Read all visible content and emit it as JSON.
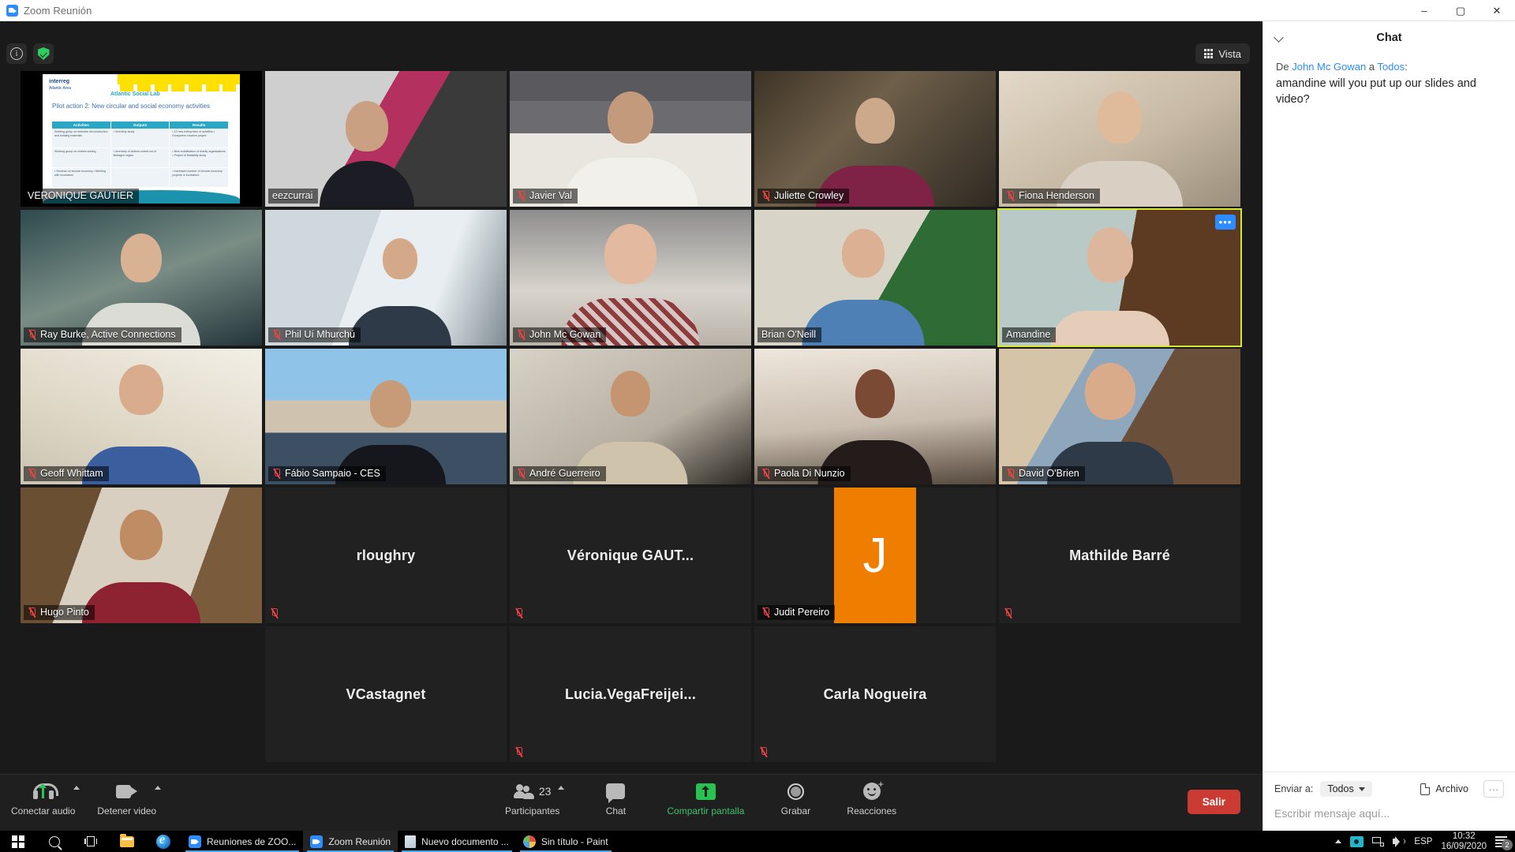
{
  "window": {
    "title": "Zoom Reunión",
    "app_icon": "zoom-icon",
    "minimize": "–",
    "maximize": "▢",
    "close": "✕"
  },
  "topbar": {
    "info_icon": "info-icon",
    "encryption_icon": "shield-check-icon",
    "view_button": "Vista",
    "view_icon": "grid-icon"
  },
  "participants": [
    {
      "name": "VERONIQUE GAUTIER",
      "muted": false,
      "kind": "screenshare",
      "row": 1
    },
    {
      "name": "eezcurrai",
      "muted": false,
      "kind": "video",
      "row": 1
    },
    {
      "name": "Javier Val",
      "muted": true,
      "kind": "video",
      "row": 1
    },
    {
      "name": "Juliette Crowley",
      "muted": true,
      "kind": "video",
      "row": 1
    },
    {
      "name": "Fiona Henderson",
      "muted": true,
      "kind": "video",
      "row": 1
    },
    {
      "name": "Ray Burke, Active Connections",
      "muted": true,
      "kind": "video",
      "row": 2
    },
    {
      "name": "Phil Uí Mhurchú",
      "muted": true,
      "kind": "video",
      "row": 2
    },
    {
      "name": "John Mc Gowan",
      "muted": true,
      "kind": "video",
      "row": 2
    },
    {
      "name": "Brian O'Neill",
      "muted": false,
      "kind": "video",
      "row": 2
    },
    {
      "name": "Amandine",
      "muted": false,
      "kind": "video",
      "row": 2,
      "active_speaker": true,
      "more_button": "•••"
    },
    {
      "name": "Geoff Whittam",
      "muted": true,
      "kind": "video",
      "row": 3
    },
    {
      "name": "Fábio Sampaio - CES",
      "muted": true,
      "kind": "video",
      "row": 3
    },
    {
      "name": "André Guerreiro",
      "muted": true,
      "kind": "video",
      "row": 3
    },
    {
      "name": "Paola Di Nunzio",
      "muted": true,
      "kind": "video",
      "row": 3
    },
    {
      "name": "David O'Brien",
      "muted": true,
      "kind": "video",
      "row": 3
    },
    {
      "name": "Hugo Pinto",
      "muted": true,
      "kind": "video",
      "row": 4
    },
    {
      "name": "rloughry",
      "muted": true,
      "kind": "placeholder",
      "row": 4
    },
    {
      "name": "Véronique  GAUT...",
      "muted": true,
      "kind": "placeholder",
      "row": 4
    },
    {
      "name": "Judit Pereiro",
      "muted": true,
      "kind": "avatar",
      "initial": "J",
      "avatar_color": "#ef7d00",
      "row": 4
    },
    {
      "name": "Mathilde Barré",
      "muted": true,
      "kind": "placeholder",
      "row": 4
    },
    {
      "name": "VCastagnet",
      "muted": false,
      "kind": "placeholder",
      "row": 5
    },
    {
      "name": "Lucia.VegaFreijei...",
      "muted": true,
      "kind": "placeholder",
      "row": 5
    },
    {
      "name": "Carla Nogueira",
      "muted": true,
      "kind": "placeholder",
      "row": 5
    }
  ],
  "shared_slide": {
    "brand": "interreg",
    "brand_sub": "Atlantic Area",
    "brand_sub2": "European Regional Development Fund",
    "project": "Atlantic Social Lab",
    "title": "Pilot action 2: New circular and social economy activities",
    "columns": [
      "Activities",
      "Outputs",
      "Results"
    ],
    "rows": [
      {
        "activities": "Working group on selective deconstruction and building materials",
        "outputs": "• Inventory study",
        "results": "• 10 new enterprises or activities\n• Ecosystem creation project"
      },
      {
        "activities": "Working group on clothes sorting",
        "outputs": "• Inventory of clothes sorted out of Bretagne region",
        "results": "• New mobilisation of charity organisations\n• Project of feasibility study"
      },
      {
        "activities": "• Seminar on circular economy\n• Meeting with incubators",
        "outputs": "",
        "results": "• Increased number of circular economy projects in incubators"
      }
    ]
  },
  "toolbar": {
    "audio_label": "Conectar audio",
    "audio_icon": "headset-arrow-icon",
    "audio_caret": "chevron-up-icon",
    "video_label": "Detener video",
    "video_icon": "camera-icon",
    "video_caret": "chevron-up-icon",
    "participants_label": "Participantes",
    "participants_count": "23",
    "participants_icon": "people-icon",
    "participants_caret": "chevron-up-icon",
    "chat_label": "Chat",
    "chat_icon": "speech-bubble-icon",
    "share_label": "Compartir pantalla",
    "share_icon": "share-screen-icon",
    "share_color": "#3ec26a",
    "record_label": "Grabar",
    "record_icon": "record-circle-icon",
    "reactions_label": "Reacciones",
    "reactions_icon": "smiley-plus-icon",
    "leave_label": "Salir",
    "leave_color": "#cc3b33"
  },
  "chat": {
    "header": "Chat",
    "collapse_icon": "chevron-down-icon",
    "message": {
      "prefix": "De",
      "sender": "John Mc Gowan",
      "connector": "a",
      "recipient": "Todos",
      "colon": ":",
      "body": "amandine will you put up our slides and video?"
    },
    "send_to_label": "Enviar a:",
    "send_to_value": "Todos",
    "send_to_caret": "chevron-down-icon",
    "file_label": "Archivo",
    "file_icon": "file-icon",
    "more_label": "···",
    "input_placeholder": "Escribir mensaje aquí..."
  },
  "taskbar": {
    "start_icon": "windows-start-icon",
    "search_icon": "search-icon",
    "taskview_icon": "task-view-icon",
    "explorer_icon": "file-explorer-icon",
    "ie_icon": "internet-explorer-icon",
    "apps": [
      {
        "label": "Reuniones de ZOO...",
        "icon": "zoom-icon",
        "active": false
      },
      {
        "label": "Zoom Reunión",
        "icon": "zoom-icon",
        "active": true
      },
      {
        "label": "Nuevo documento ...",
        "icon": "word-icon",
        "active": false
      },
      {
        "label": "Sin título - Paint",
        "icon": "paint-icon",
        "active": false
      }
    ],
    "tray": {
      "overflow_icon": "chevron-up-icon",
      "eye_icon": "eye-icon",
      "network_icon": "network-icon",
      "volume_icon": "volume-icon",
      "language": "ESP",
      "time": "10:32",
      "date": "16/09/2020",
      "notifications_icon": "action-center-icon",
      "notifications_count": "2"
    }
  }
}
